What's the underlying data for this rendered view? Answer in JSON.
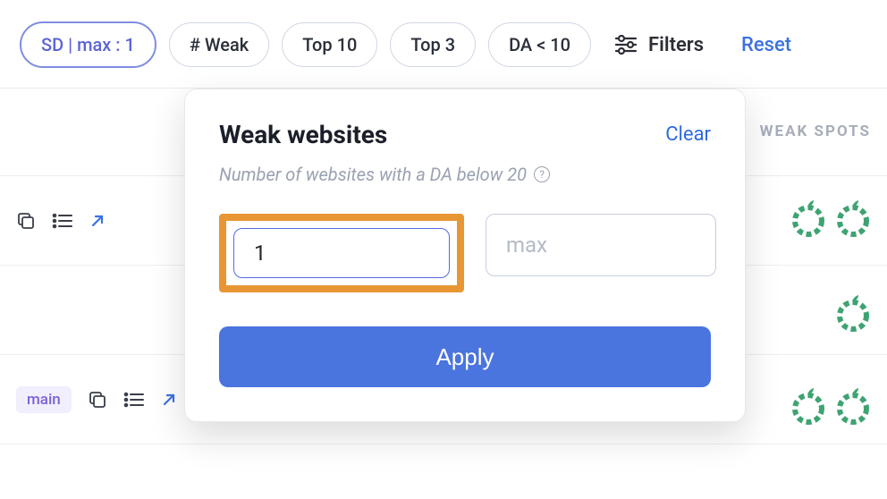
{
  "filter_bar": {
    "pills": [
      {
        "label": "SD | max : 1",
        "active": true
      },
      {
        "label": "# Weak",
        "active": false
      },
      {
        "label": "Top 10",
        "active": false
      },
      {
        "label": "Top 3",
        "active": false
      },
      {
        "label": "DA < 10",
        "active": false
      }
    ],
    "filters_label": "Filters",
    "reset_label": "Reset"
  },
  "table": {
    "weak_spots_header": "WEAK SPOTS",
    "row_tag": "main"
  },
  "popover": {
    "title": "Weak websites",
    "clear_label": "Clear",
    "subtitle": "Number of websites with a DA below 20",
    "min_value": "1",
    "max_placeholder": "max",
    "apply_label": "Apply"
  }
}
